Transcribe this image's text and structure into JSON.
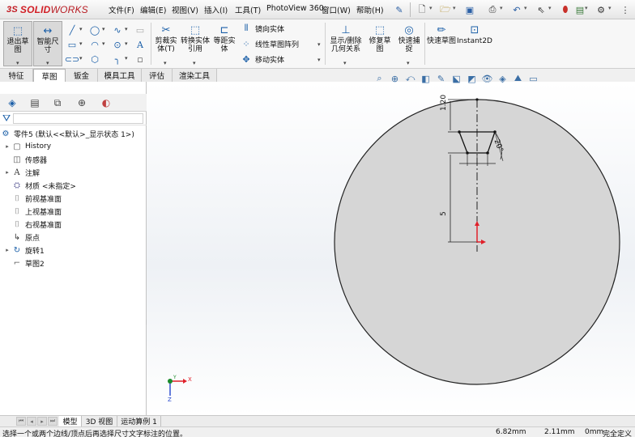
{
  "app": {
    "logo_prefix": "3S",
    "logo_main": "SOLID",
    "logo_suffix": "WORKS"
  },
  "menu": {
    "items": [
      "文件(F)",
      "编辑(E)",
      "视图(V)",
      "插入(I)",
      "工具(T)",
      "PhotoView 360",
      "窗口(W)",
      "帮助(H)"
    ]
  },
  "quick_access": [
    "new-document-icon",
    "open-icon",
    "save-icon",
    "print-icon",
    "undo-icon",
    "select-icon",
    "traffic-light-icon",
    "rebuild-icon",
    "options-icon"
  ],
  "ribbon": {
    "exit_sketch": "退出草图",
    "smart_dim": "智能尺寸",
    "trim": "剪裁实体(T)",
    "convert": "转换实体引用",
    "offset": "等距实体",
    "mirror": "镜向实体",
    "linear_pattern": "线性草图阵列",
    "move": "移动实体",
    "show_relations": "显示/删除几何关系",
    "repair": "修复草图",
    "quick_snap": "快速捕捉",
    "rapid_sketch": "快速草图",
    "instant2d": "Instant2D"
  },
  "tabs": {
    "items": [
      "特征",
      "草图",
      "钣金",
      "模具工具",
      "评估",
      "渲染工具"
    ],
    "active_index": 1
  },
  "tree": {
    "root": "零件5 (默认<<默认>_显示状态 1>)",
    "items": [
      {
        "label": "History",
        "expandable": true
      },
      {
        "label": "传感器",
        "expandable": false
      },
      {
        "label": "注解",
        "expandable": true
      },
      {
        "label": "材质 <未指定>",
        "expandable": false
      },
      {
        "label": "前视基准面",
        "expandable": false
      },
      {
        "label": "上视基准面",
        "expandable": false
      },
      {
        "label": "右视基准面",
        "expandable": false
      },
      {
        "label": "原点",
        "expandable": false
      },
      {
        "label": "旋转1",
        "expandable": true
      },
      {
        "label": "草图2",
        "expandable": false
      }
    ]
  },
  "sketch": {
    "dim_top": "1.20",
    "dim_angle": "20°",
    "dim_vertical": "5"
  },
  "triad": {
    "x": "X",
    "y": "Y",
    "z": "Z"
  },
  "bottom_tabs": {
    "items": [
      "模型",
      "3D 视图",
      "运动算例 1"
    ],
    "active_index": 0
  },
  "status": {
    "message": "选择一个或两个边线/顶点后再选择尺寸文字标注的位置。",
    "x": "6.82mm",
    "y": "2.11mm",
    "z": "0mm",
    "state": "完全定义"
  },
  "colors": {
    "accent_blue": "#1b5fa8",
    "logo_red": "#d21f26",
    "disk_gray": "#d6d6d6",
    "axis_red": "#e0202a",
    "axis_green": "#1a8a2a",
    "axis_blue": "#2244cc"
  }
}
